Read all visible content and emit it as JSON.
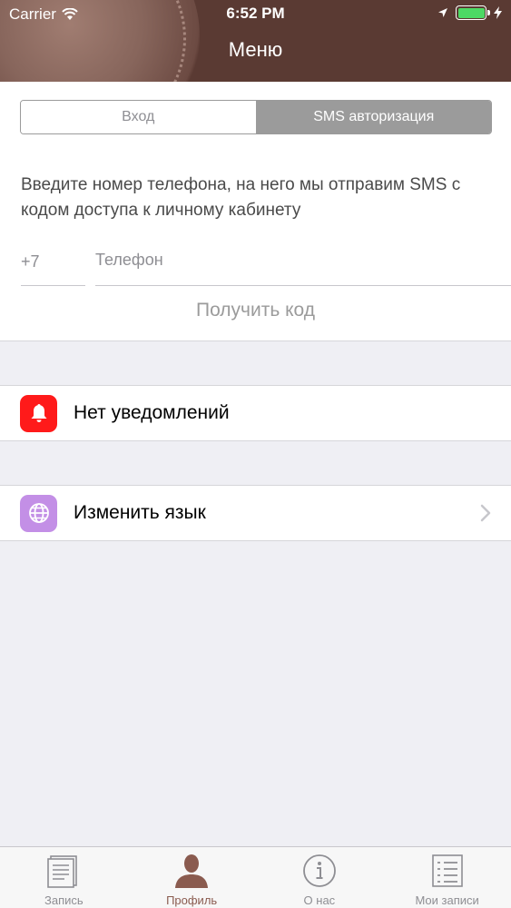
{
  "status_bar": {
    "carrier": "Carrier",
    "time": "6:52 PM"
  },
  "nav": {
    "title": "Меню"
  },
  "auth": {
    "segments": [
      {
        "label": "Вход",
        "active": false
      },
      {
        "label": "SMS авторизация",
        "active": true
      }
    ],
    "instructions": "Введите номер телефона, на него мы отправим SMS с кодом доступа к личному кабинету",
    "country_code": "+7",
    "phone_placeholder": "Телефон",
    "phone_value": "",
    "get_code_label": "Получить код"
  },
  "rows": {
    "notifications": {
      "label": "Нет уведомлений",
      "icon": "bell-icon",
      "color": "#ff1a1a"
    },
    "language": {
      "label": "Изменить язык",
      "icon": "globe-icon",
      "color": "#c38fe6"
    }
  },
  "tabbar": {
    "tabs": [
      {
        "label": "Запись",
        "icon": "document-icon",
        "active": false
      },
      {
        "label": "Профиль",
        "icon": "person-icon",
        "active": true
      },
      {
        "label": "О нас",
        "icon": "info-icon",
        "active": false
      },
      {
        "label": "Мои записи",
        "icon": "list-icon",
        "active": false
      }
    ]
  },
  "colors": {
    "header": "#5a3a33",
    "battery": "#4cd964",
    "active_tab": "#8a5b4f"
  }
}
